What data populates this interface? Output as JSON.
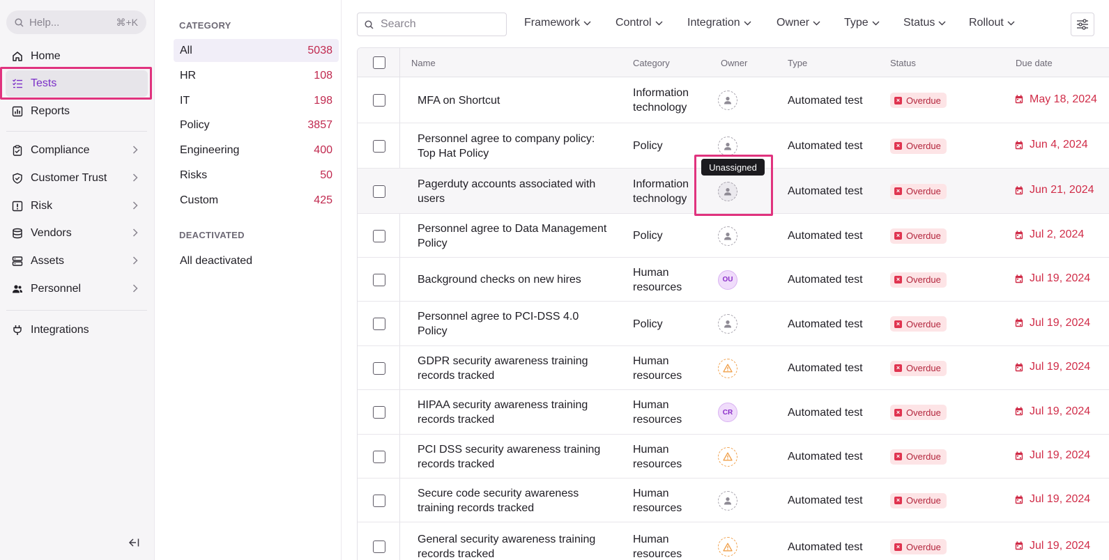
{
  "sidebar": {
    "help_placeholder": "Help...",
    "help_shortcut": "⌘+K",
    "items": [
      {
        "label": "Home",
        "icon": "home-icon"
      },
      {
        "label": "Tests",
        "icon": "checklist-icon"
      },
      {
        "label": "Reports",
        "icon": "chart-icon"
      },
      {
        "label": "Compliance",
        "icon": "clipboard-icon"
      },
      {
        "label": "Customer Trust",
        "icon": "shield-icon"
      },
      {
        "label": "Risk",
        "icon": "alert-square-icon"
      },
      {
        "label": "Vendors",
        "icon": "database-icon"
      },
      {
        "label": "Assets",
        "icon": "server-icon"
      },
      {
        "label": "Personnel",
        "icon": "people-icon"
      },
      {
        "label": "Integrations",
        "icon": "plug-icon"
      }
    ]
  },
  "categories": {
    "heading": "CATEGORY",
    "items": [
      {
        "label": "All",
        "count": "5038"
      },
      {
        "label": "HR",
        "count": "108"
      },
      {
        "label": "IT",
        "count": "198"
      },
      {
        "label": "Policy",
        "count": "3857"
      },
      {
        "label": "Engineering",
        "count": "400"
      },
      {
        "label": "Risks",
        "count": "50"
      },
      {
        "label": "Custom",
        "count": "425"
      }
    ],
    "deactivated_heading": "DEACTIVATED",
    "deactivated_item": "All deactivated"
  },
  "toolbar": {
    "search_placeholder": "Search",
    "filters": [
      "Framework",
      "Control",
      "Integration",
      "Owner",
      "Type",
      "Status",
      "Rollout"
    ]
  },
  "table": {
    "columns": {
      "name": "Name",
      "category": "Category",
      "owner": "Owner",
      "type": "Type",
      "status": "Status",
      "due": "Due date"
    },
    "rows": [
      {
        "name": [
          "MFA on Shortcut"
        ],
        "category": [
          "Information",
          "technology"
        ],
        "owner": "unassigned",
        "type": "Automated test",
        "status": "Overdue",
        "due": "May 18, 2024"
      },
      {
        "name": [
          "Personnel agree to company policy:",
          "Top Hat Policy"
        ],
        "category": [
          "Policy"
        ],
        "owner": "unassigned",
        "type": "Automated test",
        "status": "Overdue",
        "due": "Jun 4, 2024"
      },
      {
        "name": [
          "Pagerduty accounts associated with",
          "users"
        ],
        "category": [
          "Information",
          "technology"
        ],
        "owner": "unassigned",
        "type": "Automated test",
        "status": "Overdue",
        "due": "Jun 21, 2024"
      },
      {
        "name": [
          "Personnel agree to Data Management",
          "Policy"
        ],
        "category": [
          "Policy"
        ],
        "owner": "unassigned",
        "type": "Automated test",
        "status": "Overdue",
        "due": "Jul 2, 2024"
      },
      {
        "name": [
          "Background checks on new hires"
        ],
        "category": [
          "Human",
          "resources"
        ],
        "owner": "OU",
        "type": "Automated test",
        "status": "Overdue",
        "due": "Jul 19, 2024"
      },
      {
        "name": [
          "Personnel agree to PCI-DSS 4.0",
          "Policy"
        ],
        "category": [
          "Policy"
        ],
        "owner": "unassigned",
        "type": "Automated test",
        "status": "Overdue",
        "due": "Jul 19, 2024"
      },
      {
        "name": [
          "GDPR security awareness training",
          "records tracked"
        ],
        "category": [
          "Human",
          "resources"
        ],
        "owner": "warning",
        "type": "Automated test",
        "status": "Overdue",
        "due": "Jul 19, 2024"
      },
      {
        "name": [
          "HIPAA security awareness training",
          "records tracked"
        ],
        "category": [
          "Human",
          "resources"
        ],
        "owner": "CR",
        "type": "Automated test",
        "status": "Overdue",
        "due": "Jul 19, 2024"
      },
      {
        "name": [
          "PCI DSS security awareness training",
          "records tracked"
        ],
        "category": [
          "Human",
          "resources"
        ],
        "owner": "warning",
        "type": "Automated test",
        "status": "Overdue",
        "due": "Jul 19, 2024"
      },
      {
        "name": [
          "Secure code security awareness",
          "training records tracked"
        ],
        "category": [
          "Human",
          "resources"
        ],
        "owner": "unassigned",
        "type": "Automated test",
        "status": "Overdue",
        "due": "Jul 19, 2024"
      },
      {
        "name": [
          "General security awareness training",
          "records tracked"
        ],
        "category": [
          "Human",
          "resources"
        ],
        "owner": "warning",
        "type": "Automated test",
        "status": "Overdue",
        "due": "Jul 19, 2024"
      }
    ]
  },
  "tooltip": "Unassigned",
  "colors": {
    "accent": "#7b2fc8",
    "highlight": "#e0337e",
    "overdue": "#d02c48"
  }
}
